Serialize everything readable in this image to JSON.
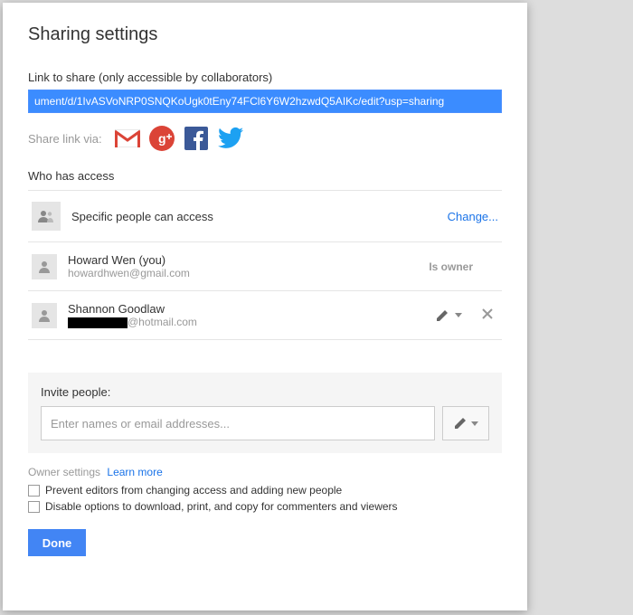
{
  "dialog": {
    "title": "Sharing settings",
    "link_label": "Link to share (only accessible by collaborators)",
    "link_value": "ument/d/1IvASVoNRP0SNQKoUgk0tEny74FCl6Y6W2hzwdQ5AIKc/edit?usp=sharing",
    "share_via_label": "Share link via:",
    "who_label": "Who has access",
    "access": {
      "summary": "Specific people can access",
      "change": "Change..."
    },
    "people": [
      {
        "name": "Howard Wen (you)",
        "email": "howardhwen@gmail.com",
        "role": "Is owner"
      },
      {
        "name": "Shannon Goodlaw",
        "email_domain": "@hotmail.com",
        "role": "editor"
      }
    ],
    "invite": {
      "label": "Invite people:",
      "placeholder": "Enter names or email addresses..."
    },
    "owner_settings": {
      "label": "Owner settings",
      "learn_more": "Learn more",
      "opt1": "Prevent editors from changing access and adding new people",
      "opt2": "Disable options to download, print, and copy for commenters and viewers"
    },
    "done": "Done"
  }
}
